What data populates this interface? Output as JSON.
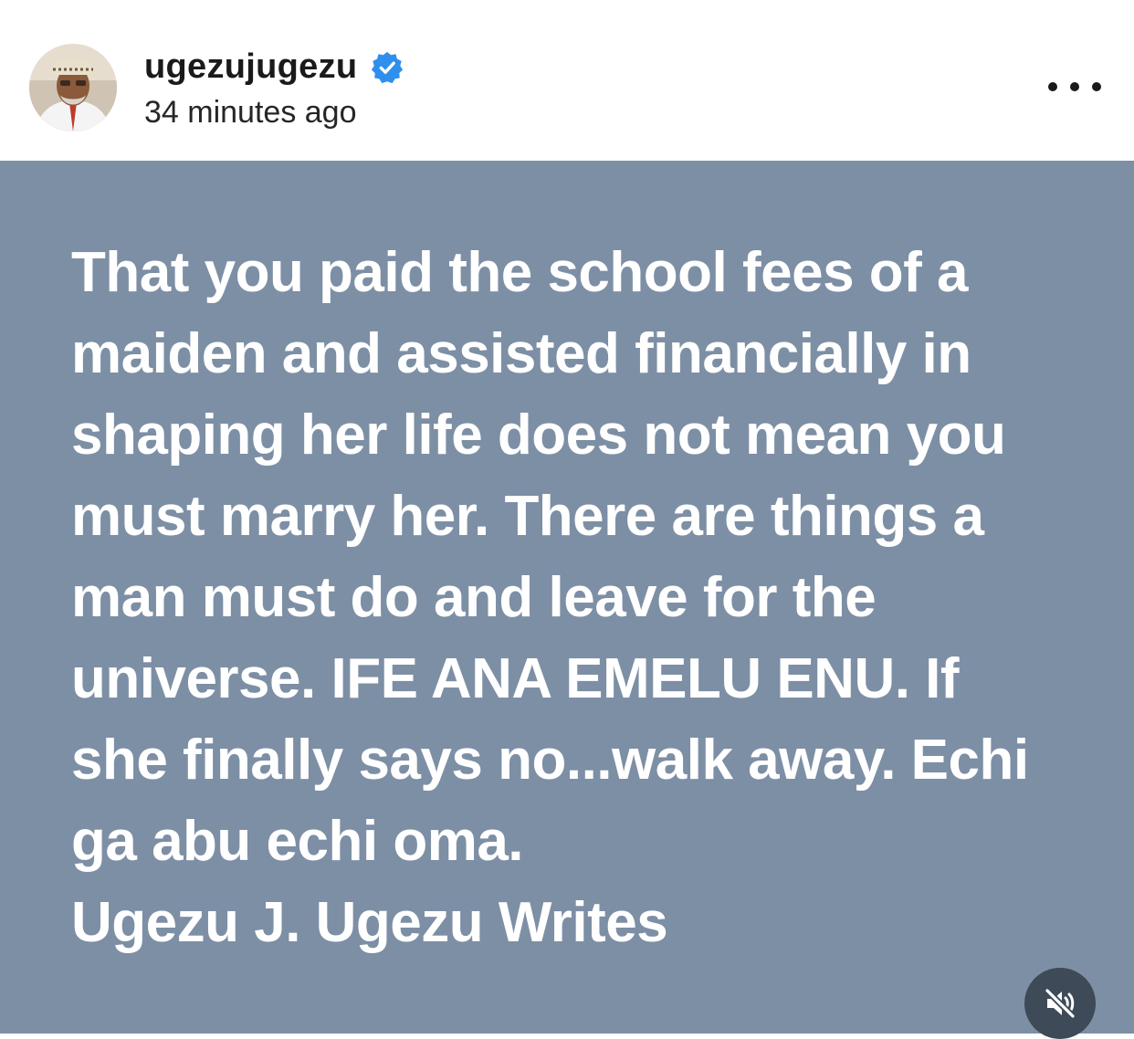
{
  "header": {
    "username": "ugezujugezu",
    "verified": true,
    "timestamp": "34 minutes ago",
    "avatar_icon": "profile-photo",
    "more_icon": "more-horizontal-icon"
  },
  "post": {
    "background_color": "#7d8fa5",
    "text": "That you paid the school fees of a\nmaiden and assisted financially in\nshaping her life does not mean you\nmust marry her. There are things a\nman must do and leave for the\nuniverse. IFE ANA EMELU ENU. If\nshe finally says no...walk away. Echi\nga abu echi oma.\nUgezu J. Ugezu Writes",
    "mute_icon": "speaker-muted-icon"
  },
  "colors": {
    "verified_badge": "#2f8fec",
    "text": "#ffffff",
    "mute_button_bg": "#3e4a58"
  }
}
